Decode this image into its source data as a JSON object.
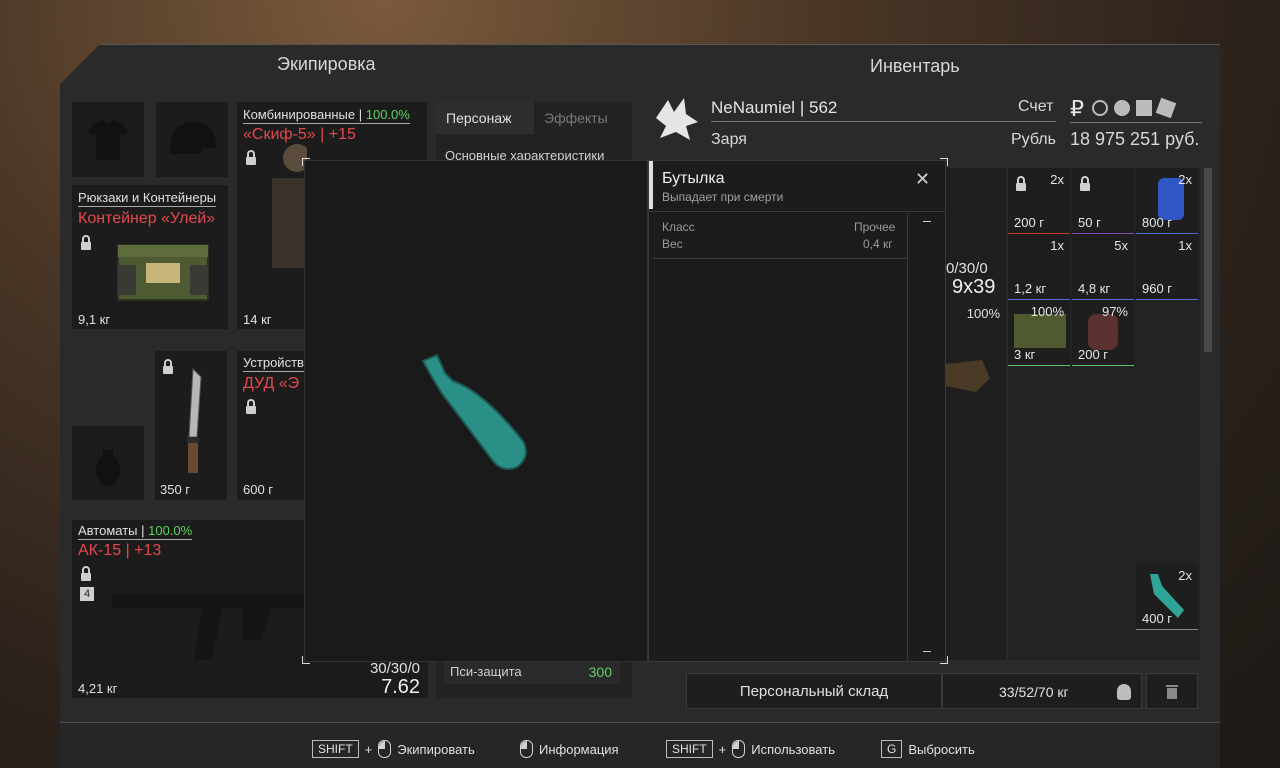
{
  "headers": {
    "equipment": "Экипировка",
    "inventory": "Инвентарь"
  },
  "equipment": {
    "armor": {
      "label": "Комбинированные |",
      "condition": "100.0%",
      "name": "«Скиф-5» | +15",
      "weight": "14 кг"
    },
    "backpack": {
      "label": "Рюкзаки и Контейнеры",
      "name": "Контейнер «Улей»",
      "weight": "9,1 кг"
    },
    "device": {
      "label": "Устройств",
      "name": "ДУД «Э",
      "weight": "600 г"
    },
    "knife": {
      "weight": "350 г"
    },
    "rifle": {
      "label": "Автоматы |",
      "condition": "100.0%",
      "name": "АК-15 | +13",
      "weight": "4,21 кг",
      "ammo": "30/30/0",
      "caliber": "7.62",
      "badge": "4"
    }
  },
  "stats_panel": {
    "tabs": [
      "Персонаж",
      "Эффекты"
    ],
    "section": "Основные характеристики",
    "psi_label": "Пси-защита",
    "psi_value": "300"
  },
  "profile": {
    "name": "NeNaumiel",
    "sep": "|",
    "level": "562",
    "faction": "Заря",
    "account_label": "Счет",
    "currency_label": "Рубль",
    "balance": "18 975 251 руб."
  },
  "inventory_cells": [
    {
      "count": "2x",
      "weight": "200 г",
      "color": "#c0392b"
    },
    {
      "count": "",
      "weight": "50 г",
      "color": "#7e4ab3"
    },
    {
      "count": "2x",
      "weight": "800 г",
      "color": "#4a6fd1"
    },
    {
      "count": "1x",
      "weight": "1,2 кг",
      "color": "#4a6fd1"
    },
    {
      "count": "5x",
      "weight": "4,8 кг",
      "color": "#4a6fd1"
    },
    {
      "count": "1x",
      "weight": "960 г",
      "color": "#4a6fd1"
    },
    {
      "count": "100%",
      "weight": "3 кг",
      "color": "#56c271"
    },
    {
      "count": "97%",
      "weight": "200 г",
      "color": "#56c271"
    },
    {
      "count": "2x",
      "weight": "400 г",
      "color": "#8a8a8a"
    }
  ],
  "partial_item": {
    "ammo": "0/30/0",
    "caliber": "9x39",
    "condition": "100%"
  },
  "storage": {
    "label": "Персональный склад",
    "weight": "33/52/70 кг"
  },
  "modal": {
    "title": "Бутылка",
    "subtitle": "Выпадает при смерти",
    "rows": [
      {
        "key": "Класс",
        "value": "Прочее"
      },
      {
        "key": "Вес",
        "value": "0,4 кг"
      }
    ]
  },
  "hints": [
    {
      "key": "SHIFT",
      "plus": "+",
      "action": "Экипировать"
    },
    {
      "key": "",
      "plus": "",
      "action": "Информация"
    },
    {
      "key": "SHIFT",
      "plus": "+",
      "action": "Использовать"
    },
    {
      "key": "G",
      "plus": "",
      "action": "Выбросить"
    }
  ]
}
